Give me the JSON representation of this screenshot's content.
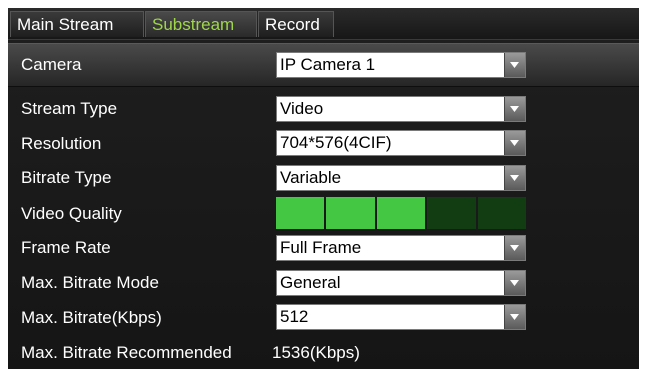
{
  "tabs": [
    {
      "label": "Main Stream",
      "active": false
    },
    {
      "label": "Substream",
      "active": true
    },
    {
      "label": "Record",
      "active": false
    }
  ],
  "camera": {
    "label": "Camera",
    "value": "IP Camera 1"
  },
  "fields": {
    "stream_type": {
      "label": "Stream Type",
      "value": "Video"
    },
    "resolution": {
      "label": "Resolution",
      "value": "704*576(4CIF)"
    },
    "bitrate_type": {
      "label": "Bitrate Type",
      "value": "Variable"
    },
    "video_quality": {
      "label": "Video Quality",
      "level": 3,
      "max": 5
    },
    "frame_rate": {
      "label": "Frame Rate",
      "value": "Full Frame"
    },
    "max_bitrate_mode": {
      "label": "Max. Bitrate Mode",
      "value": "General"
    },
    "max_bitrate": {
      "label": "Max. Bitrate(Kbps)",
      "value": "512"
    },
    "recommended": {
      "label": "Max. Bitrate Recommended",
      "value": "1536(Kbps)"
    }
  },
  "colors": {
    "active_tab_text": "#9fd64a",
    "quality_on": "#44c844",
    "quality_off": "#123d12"
  }
}
